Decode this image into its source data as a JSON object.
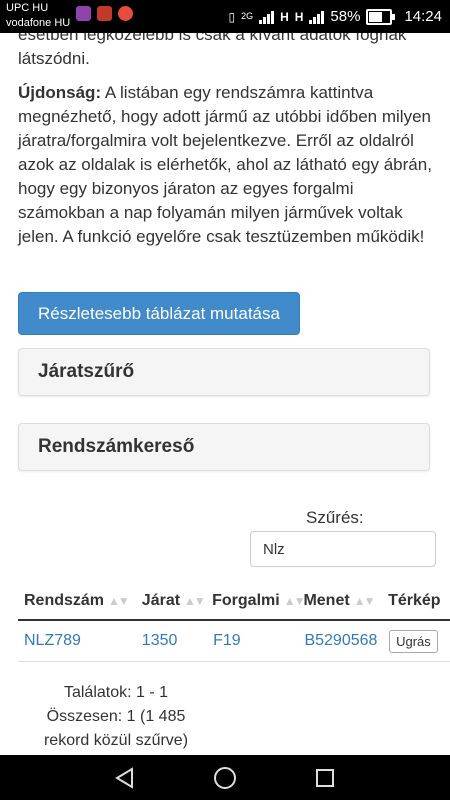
{
  "status_bar": {
    "carrier_primary": "UPC HU",
    "carrier_secondary": "vodafone HU",
    "network_2g": "2G",
    "network_h1": "H",
    "network_h2": "H",
    "battery_percent": "58%",
    "battery_level": 0.58,
    "time": "14:24",
    "icons": [
      "gallery-app-icon",
      "huawei-app-icon",
      "record-app-icon"
    ]
  },
  "content": {
    "intro_fragment": "esetben legközelebb is csak a kívánt adatok fognak látszódni.",
    "news_label": "Újdonság:",
    "news_text": " A listában egy rendszámra kattintva megnézhető, hogy adott jármű az utóbbi időben milyen járatra/forgalmira volt bejelentkezve. Erről az oldalról azok az oldalak is elérhetők, ahol az látható egy ábrán, hogy egy bizonyos járaton az egyes forgalmi számokban a nap folyamán milyen járművek voltak jelen. A funkció egyelőre csak tesztüzemben működik!",
    "detail_button": "Részletesebb táblázat mutatása",
    "panel_route_filter": "Járatszűrő",
    "panel_plate_search": "Rendszámkereső",
    "filter_label": "Szűrés:",
    "filter_value": "Nlz"
  },
  "table": {
    "headers": [
      "Rendszám",
      "Járat",
      "Forgalmi",
      "Menet",
      "Térkép"
    ],
    "rows": [
      {
        "plate": "NLZ789",
        "route": "1350",
        "forgalmi": "F19",
        "menet": "B5290568",
        "map_button": "Ugrás"
      }
    ]
  },
  "results": {
    "line1": "Találatok: 1 - 1",
    "line2": "Összesen: 1 (1 485",
    "line3": "rekord közül szűrve)"
  },
  "colors": {
    "primary": "#428bca",
    "link": "#337ab7",
    "panel_bg": "#f5f5f5"
  }
}
